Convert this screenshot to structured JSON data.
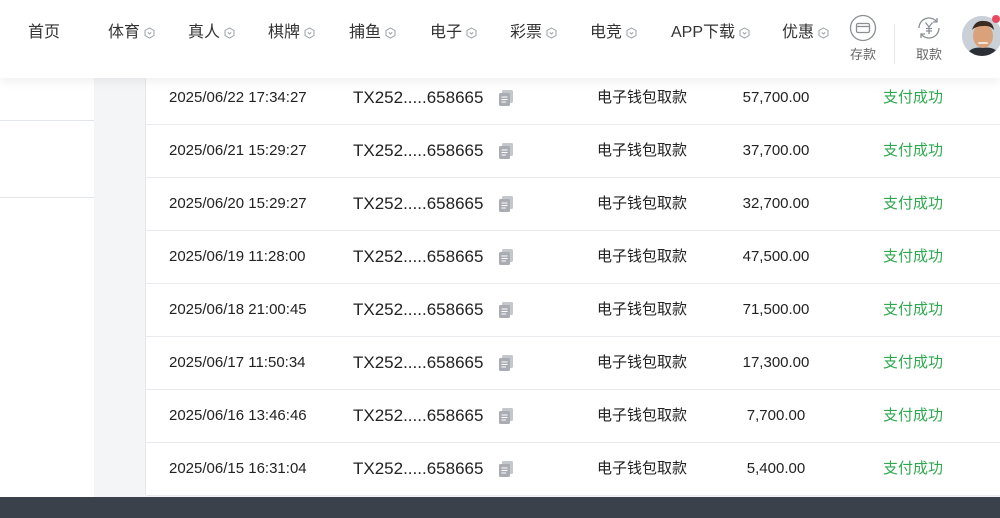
{
  "nav": {
    "items": [
      {
        "label": "首页",
        "has_icon": false
      },
      {
        "label": "体育",
        "has_icon": true
      },
      {
        "label": "真人",
        "has_icon": true
      },
      {
        "label": "棋牌",
        "has_icon": true
      },
      {
        "label": "捕鱼",
        "has_icon": true
      },
      {
        "label": "电子",
        "has_icon": true
      },
      {
        "label": "彩票",
        "has_icon": true
      },
      {
        "label": "电竞",
        "has_icon": true
      },
      {
        "label": "APP下载",
        "has_icon": true
      },
      {
        "label": "优惠",
        "has_icon": true
      }
    ],
    "deposit_label": "存款",
    "withdraw_label": "取款",
    "deposit_icon": "card-icon",
    "withdraw_icon": "yen-exchange-icon"
  },
  "colors": {
    "success": "#2fa84f",
    "bottom_bar": "#3b414b",
    "text": "#222222"
  },
  "records": [
    {
      "time": "2025/06/22 17:34:27",
      "id": "TX252.....658665",
      "type": "电子钱包取款",
      "amount": "57,700.00",
      "status": "支付成功"
    },
    {
      "time": "2025/06/21 15:29:27",
      "id": "TX252.....658665",
      "type": "电子钱包取款",
      "amount": "37,700.00",
      "status": "支付成功"
    },
    {
      "time": "2025/06/20 15:29:27",
      "id": "TX252.....658665",
      "type": "电子钱包取款",
      "amount": "32,700.00",
      "status": "支付成功"
    },
    {
      "time": "2025/06/19 11:28:00",
      "id": "TX252.....658665",
      "type": "电子钱包取款",
      "amount": "47,500.00",
      "status": "支付成功"
    },
    {
      "time": "2025/06/18 21:00:45",
      "id": "TX252.....658665",
      "type": "电子钱包取款",
      "amount": "71,500.00",
      "status": "支付成功"
    },
    {
      "time": "2025/06/17 11:50:34",
      "id": "TX252.....658665",
      "type": "电子钱包取款",
      "amount": "17,300.00",
      "status": "支付成功"
    },
    {
      "time": "2025/06/16 13:46:46",
      "id": "TX252.....658665",
      "type": "电子钱包取款",
      "amount": "7,700.00",
      "status": "支付成功"
    },
    {
      "time": "2025/06/15 16:31:04",
      "id": "TX252.....658665",
      "type": "电子钱包取款",
      "amount": "5,400.00",
      "status": "支付成功"
    }
  ]
}
